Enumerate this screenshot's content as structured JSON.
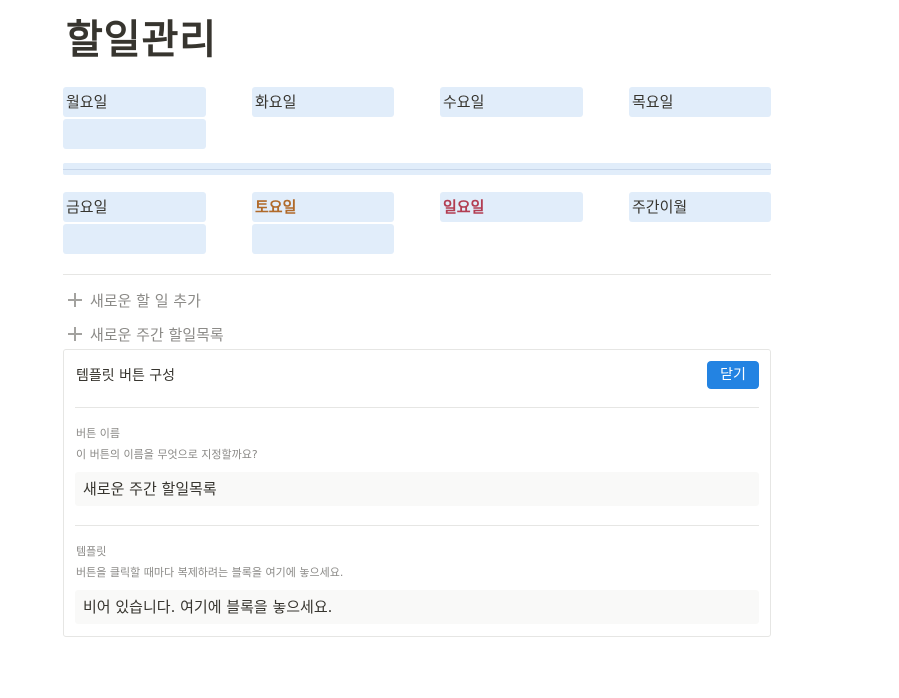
{
  "page": {
    "title": "할일관리"
  },
  "week_grid": {
    "row1": [
      "월요일",
      "화요일",
      "수요일",
      "목요일"
    ],
    "row2": [
      "금요일",
      "토요일",
      "일요일",
      "주간이월"
    ]
  },
  "actions": {
    "add_todo": "새로운 할 일 추가",
    "add_weekly_list": "새로운 주간 할일목록"
  },
  "template_panel": {
    "title": "템플릿 버튼 구성",
    "close_label": "닫기",
    "button_name": {
      "label": "버튼 이름",
      "help": "이 버튼의 이름을 무엇으로 지정할까요?",
      "value": "새로운 주간 할일목록"
    },
    "template": {
      "label": "템플릿",
      "help": "버튼을 클릭할 때마다 복제하려는 블록을 여기에 놓으세요.",
      "placeholder": "비어 있습니다. 여기에 블록을 놓으세요."
    }
  },
  "colors": {
    "cell_bg": "#e1edfa",
    "saturday": "#b06a2a",
    "sunday": "#b23d52",
    "button_blue": "#2383e2"
  }
}
